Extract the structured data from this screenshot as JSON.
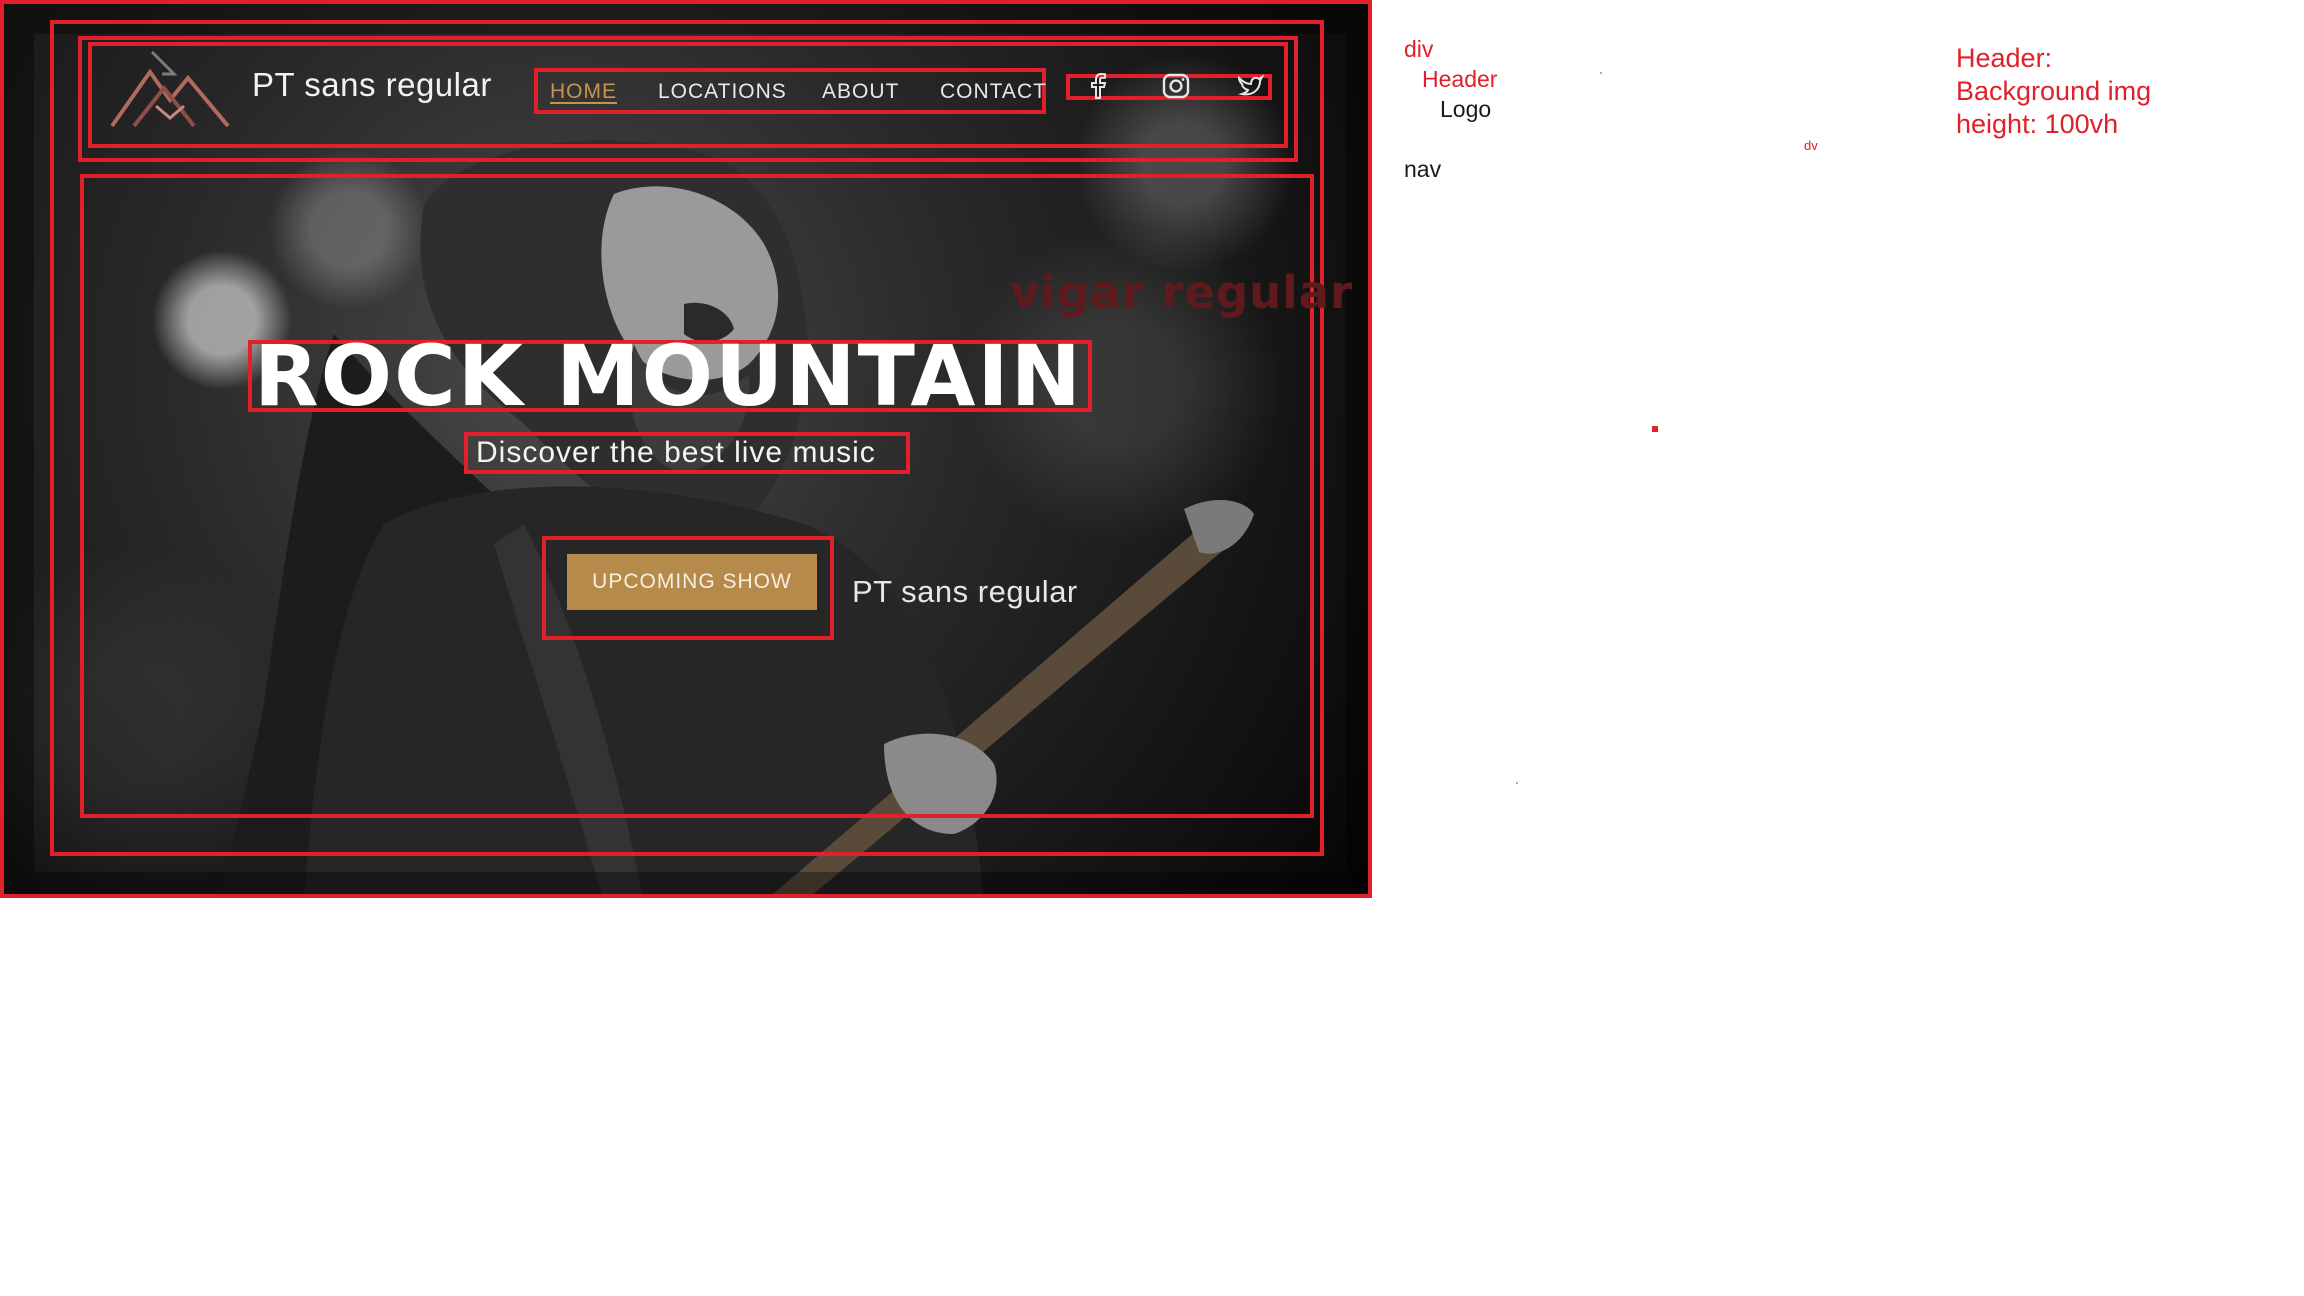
{
  "brand": {
    "name": "PT sans regular"
  },
  "nav": {
    "items": [
      {
        "label": "HOME",
        "active": true
      },
      {
        "label": "LOCATIONS",
        "active": false
      },
      {
        "label": "ABOUT",
        "active": false
      },
      {
        "label": "CONTACT",
        "active": false
      }
    ]
  },
  "social": {
    "icons": [
      "facebook-icon",
      "instagram-icon",
      "twitter-icon"
    ]
  },
  "hero": {
    "font_note": "vigar regular",
    "title": "ROCK MOUNTAIN",
    "subtitle": "Discover the best live music",
    "cta_label": "UPCOMING SHOW",
    "cta_font_note": "PT sans regular"
  },
  "colors": {
    "annotation_red": "#e0202a",
    "accent_gold": "#b58a4a",
    "nav_active": "#c6954d",
    "script_label": "#5e1a1d"
  },
  "annotations": {
    "div": "div",
    "header": "Header",
    "logo": "Logo",
    "nav": "nav",
    "small_dv": "dv",
    "header_note": [
      "Header:",
      "Background img",
      "height: 100vh"
    ]
  }
}
